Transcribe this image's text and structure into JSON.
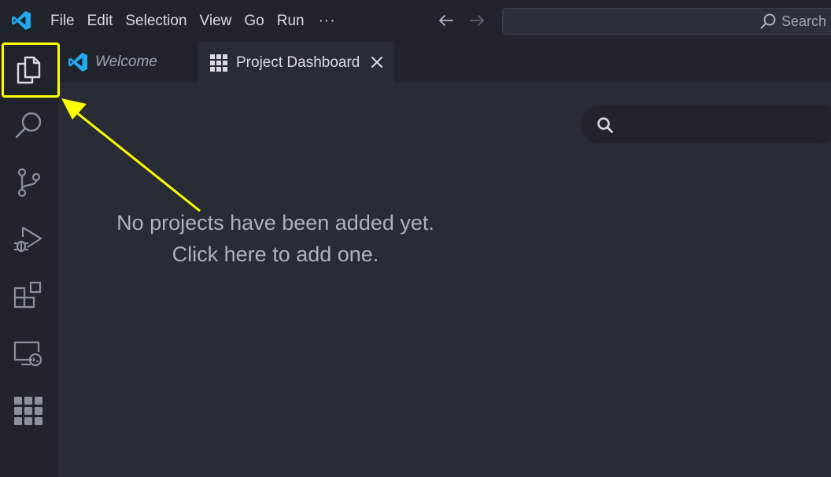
{
  "menu": {
    "items": [
      "File",
      "Edit",
      "Selection",
      "View",
      "Go",
      "Run"
    ],
    "more": "···"
  },
  "command_center": {
    "label": "Search"
  },
  "tabs": [
    {
      "label": "Welcome",
      "icon": "vscode-logo-icon"
    },
    {
      "label": "Project Dashboard",
      "icon": "grid-icon",
      "active": true
    }
  ],
  "activity_bar": [
    "explorer-icon",
    "search-icon",
    "source-control-icon",
    "run-debug-icon",
    "extensions-icon",
    "remote-explorer-icon",
    "project-dashboard-icon"
  ],
  "dashboard": {
    "empty_line1": "No projects have been added yet.",
    "empty_line2": "Click here to add one."
  },
  "colors": {
    "background": "#282c34",
    "chrome": "#21252b",
    "annotation": "#ffff00",
    "vscode_blue": "#23a9f2"
  }
}
